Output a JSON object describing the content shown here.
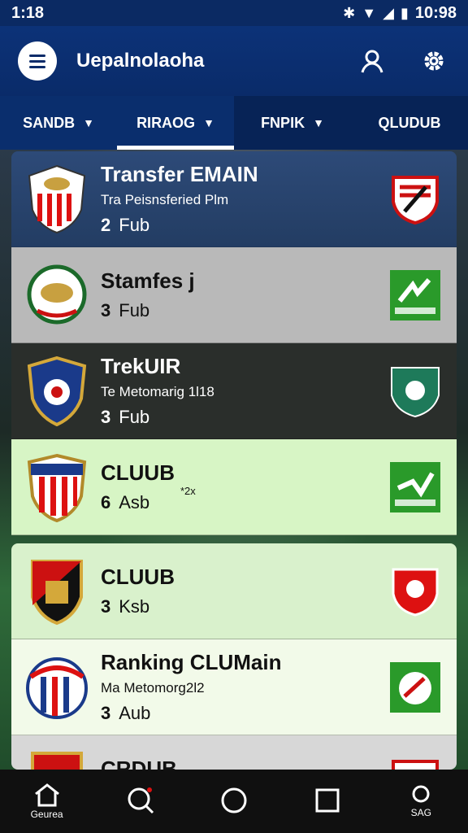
{
  "status_bar": {
    "time": "1:18",
    "clock": "10:98",
    "icons": [
      "bluetooth-icon",
      "wifi-icon",
      "signal-icon",
      "battery-icon"
    ]
  },
  "app_bar": {
    "title": "Uepalnolaoha",
    "icons": [
      "menu-icon",
      "profile-icon",
      "settings-icon"
    ]
  },
  "tabs": [
    {
      "label": "SANDB",
      "has_caret": true
    },
    {
      "label": "RIRAOG",
      "has_caret": true,
      "active": true
    },
    {
      "label": "FNPIK",
      "has_caret": true
    },
    {
      "label": "QLUDUB",
      "has_caret": false
    }
  ],
  "cards": [
    {
      "title": "Transfer EMAIN",
      "subtitle": "Tra Peisnsferied Plm",
      "count": "2",
      "unit": "Fub"
    },
    {
      "title": "Stamfes j",
      "subtitle": "",
      "count": "3",
      "unit": "Fub"
    },
    {
      "title": "TrekUIR",
      "subtitle": "Te Metomarig 1l18",
      "count": "3",
      "unit": "Fub"
    },
    {
      "title": "CLUUB",
      "subtitle": "",
      "count": "6",
      "unit": "Asb",
      "mark": "*2x"
    },
    {
      "title": "CLUUB",
      "subtitle": "",
      "count": "3",
      "unit": "Ksb"
    },
    {
      "title": "Ranking CLUMain",
      "subtitle": "Ma Metomorg2l2",
      "count": "3",
      "unit": "Aub"
    },
    {
      "title": "CRDUB",
      "subtitle": "",
      "count": "",
      "unit": ""
    }
  ],
  "bottom_nav": [
    {
      "icon": "home-icon",
      "label": "Geurea"
    },
    {
      "icon": "search-icon",
      "label": ""
    },
    {
      "icon": "circle-icon",
      "label": ""
    },
    {
      "icon": "square-icon",
      "label": ""
    },
    {
      "icon": "account-icon",
      "label": "SAG"
    }
  ],
  "colors": {
    "primary": "#0a2b69",
    "tab_bar": "#0a2e6d",
    "highlight_green": "#d7f5c5"
  }
}
